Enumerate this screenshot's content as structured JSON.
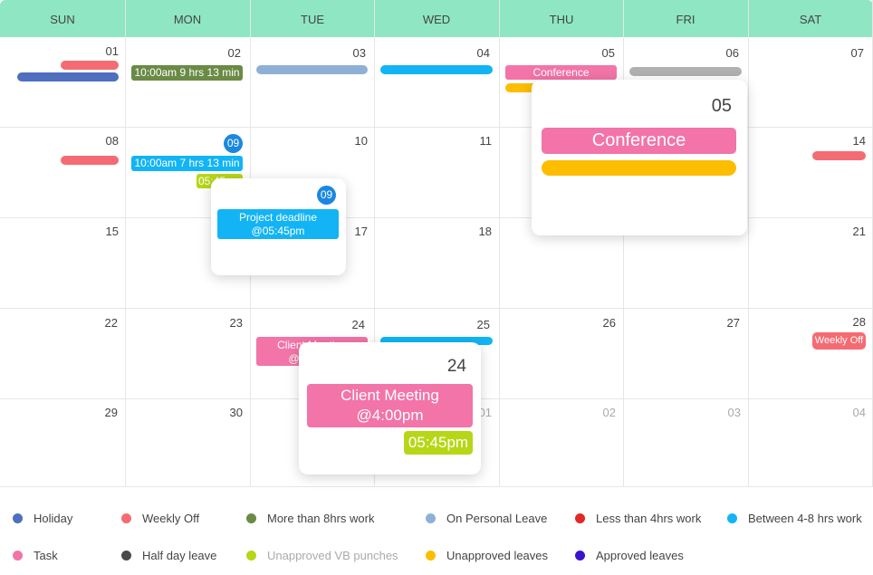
{
  "weekdays": [
    "SUN",
    "MON",
    "TUE",
    "WED",
    "THU",
    "FRI",
    "SAT"
  ],
  "dates": {
    "r1": [
      "01",
      "02",
      "03",
      "04",
      "05",
      "06",
      "07"
    ],
    "r2": [
      "08",
      "09",
      "10",
      "11",
      "14"
    ],
    "r3": [
      "15",
      "17",
      "18",
      "21"
    ],
    "r4": [
      "22",
      "23",
      "24",
      "25",
      "26",
      "27",
      "28"
    ],
    "r5": [
      "29",
      "30",
      "01",
      "02",
      "03",
      "04"
    ]
  },
  "events": {
    "mon02": "10:00am 9 hrs 13 min",
    "thu05": "Conference",
    "mon09": "10:00am 7 hrs 13 min",
    "mon09b": "05:45pm",
    "tue24": "Client Meeting @4:00pm",
    "sat28": "Weekly Off"
  },
  "popups": {
    "p09": {
      "date": "09",
      "event": "Project deadline @05:45pm"
    },
    "p05": {
      "date": "05",
      "event": "Conference"
    },
    "p24": {
      "date": "24",
      "event": "Client Meeting @4:00pm",
      "time": "05:45pm"
    }
  },
  "colors": {
    "header": "#8ee6c3",
    "holiday": "#4f6fbf",
    "weekly_off": "#f56b73",
    "more8": "#6a8a45",
    "personal": "#8fb0d6",
    "less4": "#e32626",
    "between": "#12b4f4",
    "task": "#f274a8",
    "half": "#4a4a4a",
    "vb": "#b7d617",
    "unapproved": "#fdbd00",
    "approved": "#3a13cf",
    "leave_gray": "#b0b0b0"
  },
  "legend": [
    {
      "label": "Holiday",
      "color": "#4f6fbf"
    },
    {
      "label": "Weekly Off",
      "color": "#f56b73"
    },
    {
      "label": "More than 8hrs work",
      "color": "#6a8a45"
    },
    {
      "label": "On Personal Leave",
      "color": "#8fb0d6"
    },
    {
      "label": "Less than 4hrs work",
      "color": "#e32626"
    },
    {
      "label": "Between 4-8 hrs work",
      "color": "#12b4f4"
    },
    {
      "label": "Task",
      "color": "#f274a8"
    },
    {
      "label": "Half day leave",
      "color": "#4a4a4a"
    },
    {
      "label": "Unapproved VB punches",
      "color": "#b7d617"
    },
    {
      "label": "Unapproved leaves",
      "color": "#fdbd00"
    },
    {
      "label": "Approved leaves",
      "color": "#3a13cf"
    }
  ]
}
